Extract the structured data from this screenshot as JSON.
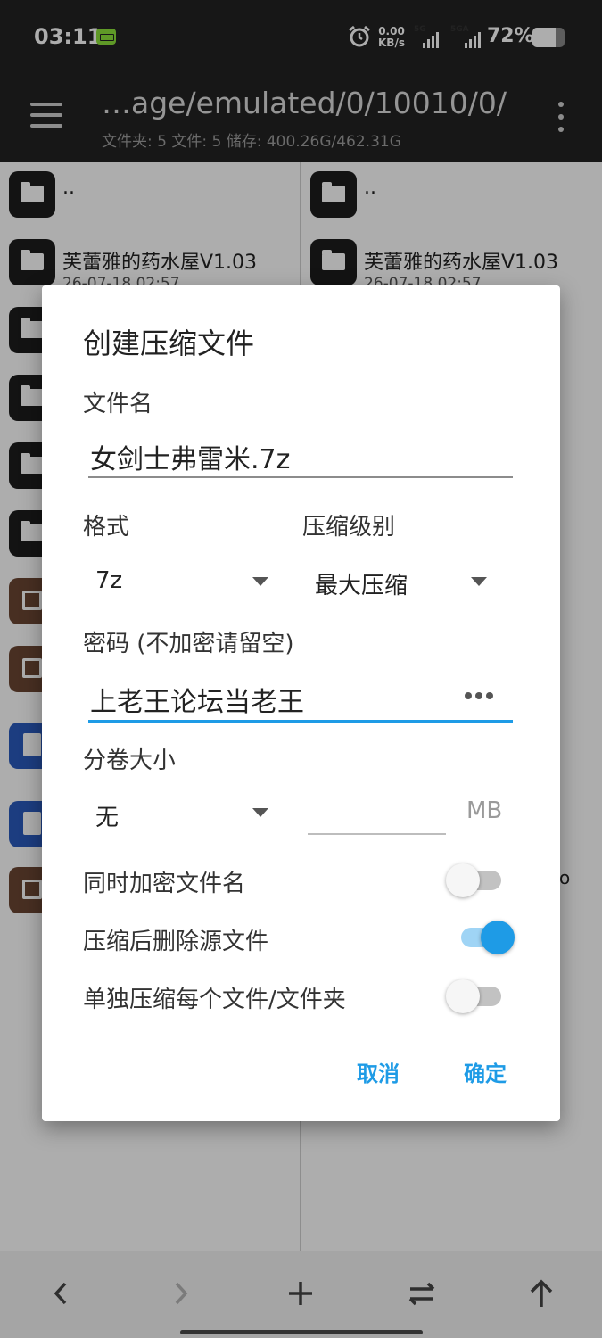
{
  "status_bar": {
    "time": "03:11",
    "net_speed_value": "0.00",
    "net_speed_unit": "KB/s",
    "sim1_label": "5G",
    "sim2_label": "5GA",
    "battery_text": "72%",
    "battery_level": 0.72
  },
  "app_bar": {
    "path": "…age/emulated/0/10010/0/",
    "summary": "文件夹: 5  文件: 5  储存: 400.26G/462.31G"
  },
  "left_pane": {
    "parent": "..",
    "item1_name": "芙蕾雅的药水屋V1.03",
    "item1_date": "26-07-18 02:57"
  },
  "right_pane": {
    "parent": "..",
    "item1_name": "芙蕾雅的药水屋V1.03",
    "item1_date": "26-07-18 02:57",
    "clipped_text": "o"
  },
  "dialog": {
    "title": "创建压缩文件",
    "filename_label": "文件名",
    "filename_value": "女剑士弗雷米.7z",
    "format_label": "格式",
    "format_value": "7z",
    "level_label": "压缩级别",
    "level_value": "最大压缩",
    "password_label": "密码 (不加密请留空)",
    "password_value": "上老王论坛当老王",
    "volume_label": "分卷大小",
    "volume_value": "无",
    "volume_unit": "MB",
    "opt_encrypt_names": "同时加密文件名",
    "opt_encrypt_names_on": false,
    "opt_delete_source": "压缩后删除源文件",
    "opt_delete_source_on": true,
    "opt_separate": "单独压缩每个文件/文件夹",
    "opt_separate_on": false,
    "cancel_label": "取消",
    "ok_label": "确定"
  },
  "colors": {
    "accent": "#1e9be6",
    "bar_dark": "#232323"
  }
}
